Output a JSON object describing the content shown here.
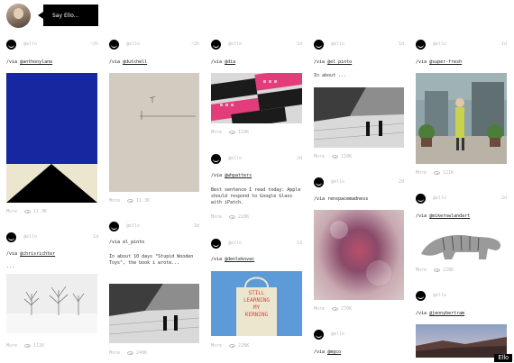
{
  "header": {
    "say_label": "Say Ello..."
  },
  "brand": {
    "badge": "Ello"
  },
  "posts": [
    {
      "user": "@ello",
      "time": "~2h",
      "via": "@anthonylane",
      "more": "More",
      "views": "11.9K"
    },
    {
      "user": "@ello",
      "time": "1d",
      "via": "@chrisrichter",
      "caption": "...",
      "more": "More",
      "views": "111K"
    },
    {
      "user": "@ello",
      "time": "~2h",
      "via": "@dutchell",
      "more": "More",
      "views": "11.3K"
    },
    {
      "user": "@ello",
      "time": "3d",
      "via": "el_pinto",
      "caption": "In about 10 days \"Stupid Wooden Toys\", the book i wrote...",
      "more": "More",
      "views": "240K"
    },
    {
      "user": "@ello",
      "time": "1d",
      "via": "@dia",
      "more": "More",
      "views": "118K"
    },
    {
      "user": "@ello",
      "time": "2d",
      "via": "@whpatters",
      "caption": "Best sentence I read today: Apple should respond to Google Glass with iPatch.",
      "more": "More",
      "views": "228K"
    },
    {
      "user": "@ello",
      "time": "1d",
      "via": "@denlekovac",
      "more": "More",
      "views": "228K"
    },
    {
      "user": "@ello",
      "time": "1d",
      "via": "@el_pinto",
      "caption": "In about ...",
      "more": "More",
      "views": "110K"
    },
    {
      "user": "@ello",
      "time": "2d",
      "via": "renspacemadness",
      "more": "More",
      "views": "270K"
    },
    {
      "user": "@ello",
      "time": "",
      "via": "@mgco"
    },
    {
      "user": "@ello",
      "time": "1d",
      "via": "@super-fresh",
      "more": "More",
      "views": "121K"
    },
    {
      "user": "@ello",
      "time": "2d",
      "via": "@mikerowlandart",
      "more": "More",
      "views": "228K"
    },
    {
      "user": "@ello",
      "time": "1d",
      "via": "@jennybertram"
    }
  ],
  "tote": {
    "lines": [
      "STILL",
      "LEARNING",
      "MY",
      "KERNING"
    ]
  },
  "colors": {
    "blue": "#1627a0",
    "cream": "#ede6cf",
    "brand": "#000000",
    "tote_bg": "#5c9bd8"
  }
}
